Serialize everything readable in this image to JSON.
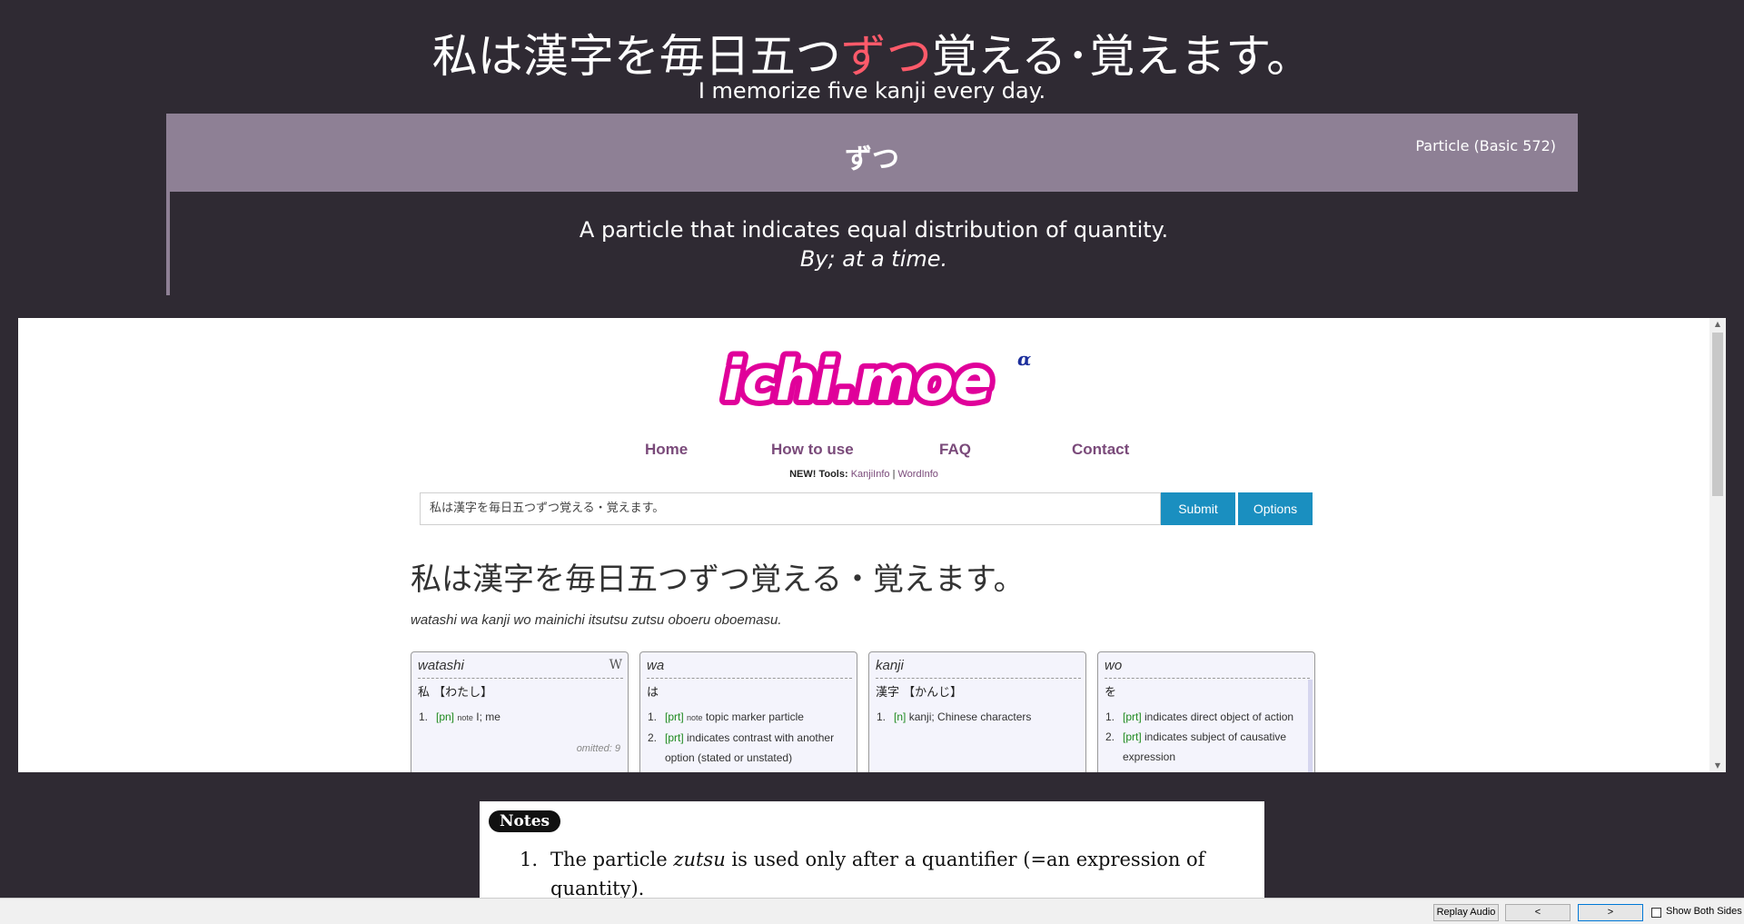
{
  "card_front": {
    "sentence_before": "私は漢字を毎日五つ",
    "sentence_highlight": "ずつ",
    "sentence_after": "覚える･覚えます。",
    "translation": "I memorize five kanji every day."
  },
  "grammar": {
    "term": "ずつ",
    "level": "Particle (Basic 572)",
    "definition": "A particle that indicates equal distribution of quantity.",
    "english": "By; at a time."
  },
  "ichimoe": {
    "logo_text": "ichi.moe",
    "logo_sup": "α",
    "nav": [
      "Home",
      "How to use",
      "FAQ",
      "Contact"
    ],
    "tools_label": "NEW! Tools:",
    "tools_link1": "KanjiInfo",
    "tools_sep": "|",
    "tools_link2": "WordInfo",
    "search_value": "私は漢字を毎日五つずつ覚える・覚えます。",
    "submit_label": "Submit",
    "options_label": "Options",
    "result_sentence": "私は漢字を毎日五つずつ覚える・覚えます。",
    "result_romaji": "watashi wa kanji wo mainichi itsutsu zutsu oboeru oboemasu.",
    "cards": [
      {
        "word": "watashi",
        "w_icon": "W",
        "reading": "私 【わたし】",
        "defs": [
          {
            "num": "1.",
            "pos": "[pn]",
            "note": "note",
            "text": "I; me"
          }
        ],
        "omitted": "omitted: 9"
      },
      {
        "word": "wa",
        "reading": "は",
        "defs": [
          {
            "num": "1.",
            "pos": "[prt]",
            "note": "note",
            "text": "topic marker particle"
          },
          {
            "num": "2.",
            "pos": "[prt]",
            "text": "indicates contrast with another option (stated or unstated)"
          }
        ]
      },
      {
        "word": "kanji",
        "reading": "漢字 【かんじ】",
        "defs": [
          {
            "num": "1.",
            "pos": "[n]",
            "text": "kanji; Chinese characters"
          }
        ]
      },
      {
        "word": "wo",
        "reading": "を",
        "defs": [
          {
            "num": "1.",
            "pos": "[prt]",
            "text": "indicates direct object of action"
          },
          {
            "num": "2.",
            "pos": "[prt]",
            "text": "indicates subject of causative expression"
          }
        ]
      }
    ]
  },
  "notes": {
    "badge": "Notes",
    "item_num": "1.",
    "text_before": "The particle",
    "text_italic": "zutsu",
    "text_after": "is used only after a quantifier (=an expression of quantity)."
  },
  "bottom_bar": {
    "replay_audio": "Replay Audio",
    "prev": "<",
    "next": ">",
    "show_both": "Show Both Sides"
  },
  "colors": {
    "background": "#2f2a33",
    "header": "#8e8095",
    "highlight": "#ff5a6a",
    "logo": "#e0009a",
    "button": "#1a8fc0"
  }
}
